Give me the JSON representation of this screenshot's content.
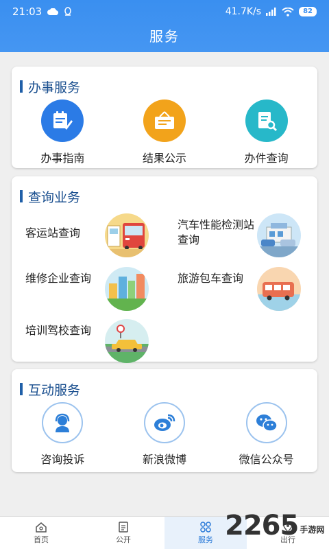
{
  "status": {
    "time": "21:03",
    "speed": "41.7K/s",
    "battery": "82"
  },
  "header": {
    "title": "服务"
  },
  "sections": {
    "ban_shi": {
      "title": "办事服务",
      "items": [
        {
          "label": "办事指南",
          "icon": "guide-icon",
          "color": "#2b7be6"
        },
        {
          "label": "结果公示",
          "icon": "notice-board-icon",
          "color": "#f2a31b"
        },
        {
          "label": "办件查询",
          "icon": "document-search-icon",
          "color": "#27b8c9"
        }
      ]
    },
    "cha_xun": {
      "title": "查询业务",
      "items": [
        {
          "label": "客运站查询",
          "icon": "bus-station-illustration"
        },
        {
          "label": "汽车性能检测站查询",
          "icon": "vehicle-inspection-illustration"
        },
        {
          "label": "维修企业查询",
          "icon": "city-buildings-illustration"
        },
        {
          "label": "旅游包车查询",
          "icon": "tour-bus-illustration"
        },
        {
          "label": "培训驾校查询",
          "icon": "driving-school-car-illustration"
        }
      ]
    },
    "hu_dong": {
      "title": "互动服务",
      "items": [
        {
          "label": "咨询投诉",
          "icon": "customer-service-icon"
        },
        {
          "label": "新浪微博",
          "icon": "weibo-icon"
        },
        {
          "label": "微信公众号",
          "icon": "wechat-icon"
        }
      ]
    }
  },
  "tabbar": {
    "tabs": [
      {
        "label": "首页",
        "icon": "home-icon"
      },
      {
        "label": "公开",
        "icon": "document-icon"
      },
      {
        "label": "服务",
        "icon": "grid-icon",
        "active": true
      },
      {
        "label": "出行",
        "icon": "location-icon"
      }
    ]
  },
  "watermark": {
    "number": "2265",
    "text": "手游网"
  },
  "colors": {
    "primary": "#3a8ff0",
    "section_bar": "#1f5fa8",
    "active_tab": "#2a7ad8"
  }
}
